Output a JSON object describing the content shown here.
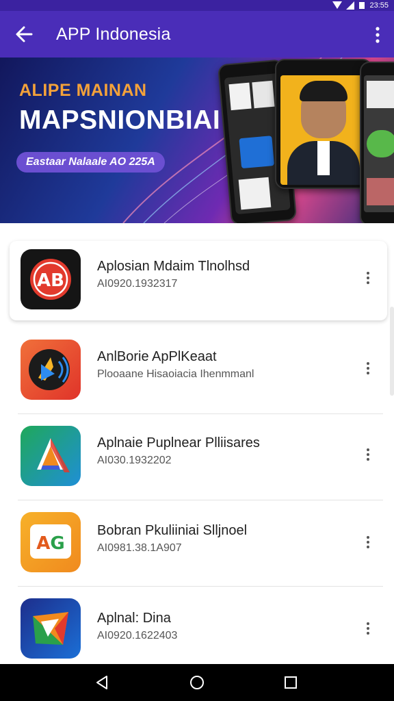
{
  "status": {
    "time": "23:55"
  },
  "appbar": {
    "title": "APP Indonesia"
  },
  "banner": {
    "subtitle": "ALIPE MAINAN",
    "headline": "MAPSNIONBIAI",
    "pill": "Eastaar Nalaale AO 225A"
  },
  "apps": [
    {
      "name": "Aplosian Mdaim Tlnolhsd",
      "meta": "AI0920.1932317",
      "icon": "ab-logo-icon"
    },
    {
      "name": "AnlBorie ApPlKeaat",
      "meta": "Plooaane Hisaoiacia Ihenmmanl",
      "icon": "audio-wave-icon"
    },
    {
      "name": "Aplnaie Puplnear Plliisares",
      "meta": "AI030.1932202",
      "icon": "triangle-a-icon"
    },
    {
      "name": "Bobran Pkuliiniai Slljnoel",
      "meta": "AI0981.38.1A907",
      "icon": "ag-logo-icon"
    },
    {
      "name": "Aplnal: Dina",
      "meta": "AI0920.1622403",
      "icon": "folded-z-icon"
    }
  ],
  "colors": {
    "appbar": "#4a2db8",
    "statusbar": "#3b22a0",
    "pill": "#6b4fd1"
  }
}
